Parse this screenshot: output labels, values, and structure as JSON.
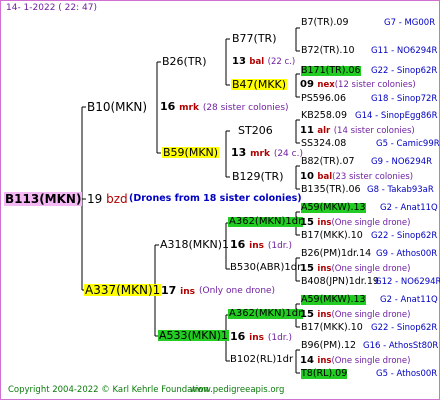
{
  "header": {
    "date": "14-  1-2022 ( 22: 47)"
  },
  "root": {
    "name": "B113(MKN)",
    "count": "19",
    "code": "bzd",
    "note": "(Drones from 18 sister colonies)"
  },
  "gen1": [
    {
      "name": "B10(MKN)",
      "count": "16",
      "code": "mrk",
      "note": "(28 sister colonies)"
    },
    {
      "name": "A337(MKN)1",
      "count": "17",
      "code": "ins",
      "note": "(Only one drone)"
    }
  ],
  "gen2": [
    {
      "name": "B26(TR)"
    },
    {
      "name": "B59(MKN)",
      "count": "13",
      "code": "mrk",
      "note": "(24 c.)"
    },
    {
      "name": "A318(MKN)1",
      "count": "16",
      "code": "ins",
      "note": "(1dr.)"
    },
    {
      "name": "A533(MKN)1",
      "count": "16",
      "code": "ins",
      "note": "(1dr.)"
    }
  ],
  "gen3": [
    {
      "name": "B77(TR)",
      "count": "13",
      "code": "bal",
      "note": "(22 c.)"
    },
    {
      "name": "B47(MKK)",
      "count": "09",
      "code": "nex",
      "note": "(12 sister colonies)"
    },
    {
      "name": "ST206",
      "count": "11",
      "code": "alr",
      "note": "(14 sister colonies)"
    },
    {
      "name": "B129(TR)",
      "count": "10",
      "code": "bal",
      "note": "(23 sister colonies)"
    },
    {
      "name": "A362(MKN)1dr",
      "count": "15",
      "code": "ins",
      "note": "(One single drone)"
    },
    {
      "name": "B530(ABR)1dr",
      "count": "15",
      "code": "ins",
      "note": "(One single drone)"
    },
    {
      "name": "A362(MKN)1dr",
      "count": "15",
      "code": "ins",
      "note": "(One single drone)"
    },
    {
      "name": "B102(RL)1dr",
      "count": "14",
      "code": "ins",
      "note": "(One single drone)"
    }
  ],
  "gen4": [
    {
      "name": "B7(TR).09",
      "ref": "G7 - MG00R"
    },
    {
      "name": "B72(TR).10",
      "ref": "G11 - NO6294R"
    },
    {
      "name": "B171(TR).06",
      "ref": "G22 - Sinop62R"
    },
    {
      "name": "PS596.06",
      "ref": "G18 - Sinop72R"
    },
    {
      "name": "KB258.09",
      "ref": "G14 - SinopEgg86R"
    },
    {
      "name": "SS324.08",
      "ref": "G5 - Camic99R"
    },
    {
      "name": "B82(TR).07",
      "ref": "G9 - NO6294R"
    },
    {
      "name": "B135(TR).06",
      "ref": "G8 - Takab93aR"
    },
    {
      "name": "A59(MKW).13",
      "ref": "G2 - Anat11Q"
    },
    {
      "name": "B17(MKK).10",
      "ref": "G22 - Sinop62R"
    },
    {
      "name": "B26(PM)1dr.14",
      "ref": "G9 - Athos00R"
    },
    {
      "name": "B408(JPN)1dr.19",
      "ref": "G12 - NO6294R"
    },
    {
      "name": "A59(MKW).13",
      "ref": "G2 - Anat11Q"
    },
    {
      "name": "B17(MKK).10",
      "ref": "G22 - Sinop62R"
    },
    {
      "name": "B96(PM).12",
      "ref": "G16 - AthosSt80R"
    },
    {
      "name": "T8(RL).09",
      "ref": "G5 - Athos00R"
    }
  ],
  "footer": {
    "copyright": "Copyright 2004-2022 © Karl Kehrle Foundation",
    "url": "www.pedigreeapis.org"
  }
}
